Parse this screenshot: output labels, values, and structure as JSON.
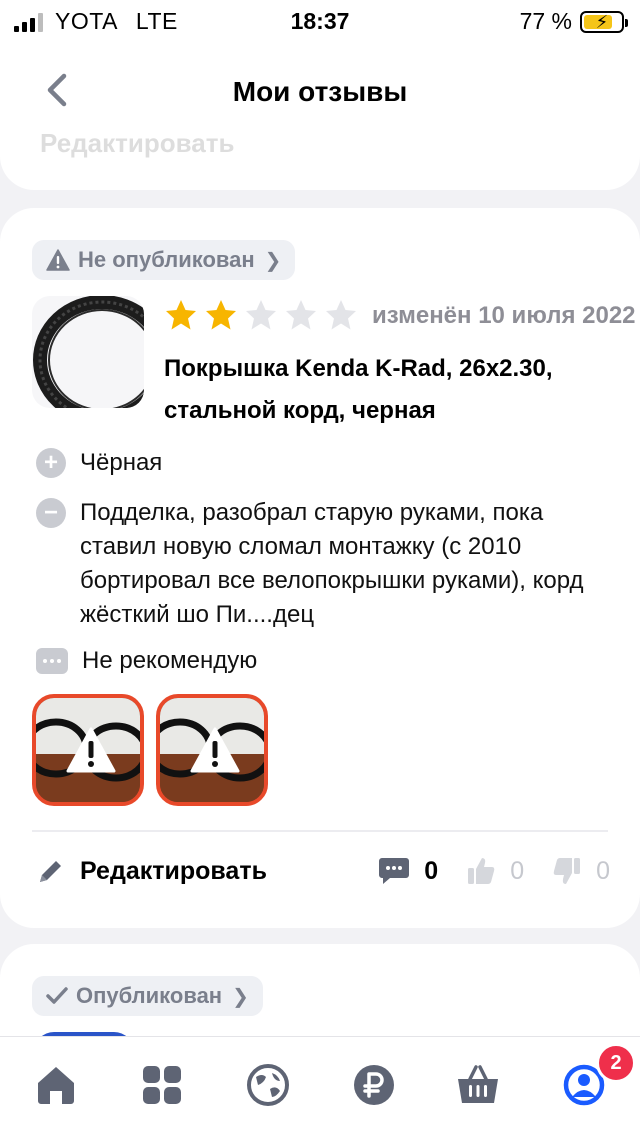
{
  "status_bar": {
    "carrier": "YOTA",
    "network": "LTE",
    "time": "18:37",
    "battery_percent": "77 %",
    "battery_level": 0.77
  },
  "header": {
    "title": "Мои отзывы"
  },
  "previous_card": {
    "edit_label": "Редактировать"
  },
  "review": {
    "status": "Не опубликован",
    "rating": 2,
    "rating_max": 5,
    "changed": "изменён 10 июля 2022",
    "product_title": "Покрышка Kenda K-Rad, 26x2.30, стальной корд, черная",
    "pros": "Чёрная",
    "cons": "Подделка, разобрал старую руками, пока ставил новую сломал монтажку (с 2010 бортировал все велопокрышки руками), корд жёсткий шо Пи....дец",
    "comment": "Не рекомендую",
    "edit_label": "Редактировать",
    "comments_count": "0",
    "likes_count": "0",
    "dislikes_count": "0"
  },
  "next_review": {
    "status": "Опубликован"
  },
  "tab_bar": {
    "items": [
      "home",
      "catalog",
      "explore",
      "payments",
      "cart",
      "profile"
    ],
    "profile_badge": "2"
  },
  "colors": {
    "star_active": "#f7b500",
    "star_inactive": "#e3e4e8",
    "photo_border": "#e8492a",
    "badge": "#ef2f4b",
    "profile_blue": "#1a5bff",
    "tab_icon": "#5e6474"
  }
}
